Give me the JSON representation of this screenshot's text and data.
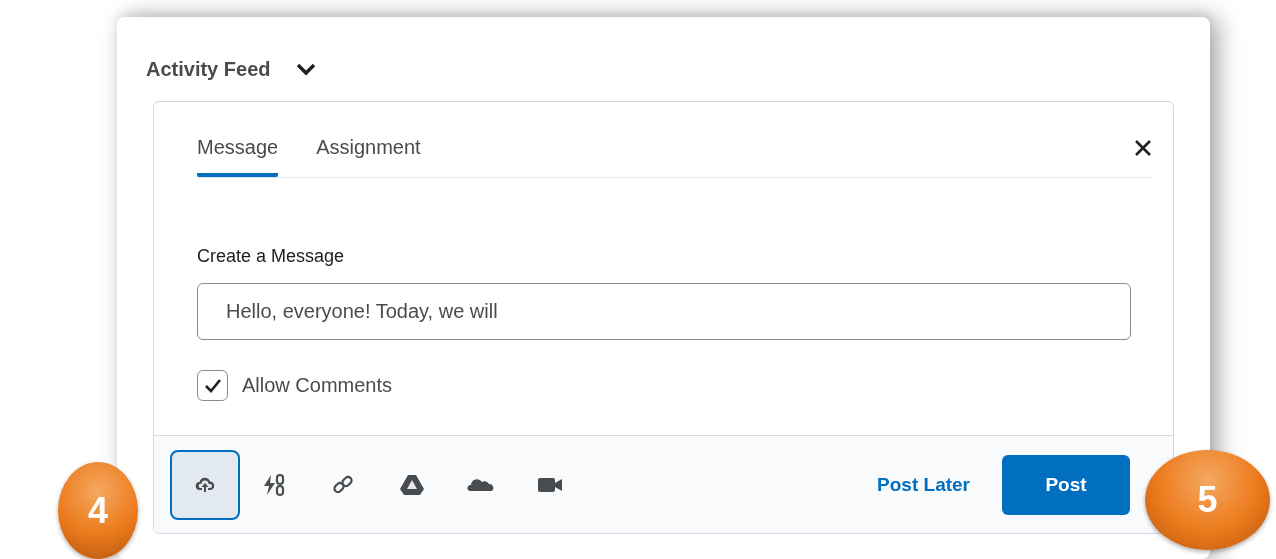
{
  "header": {
    "title": "Activity Feed"
  },
  "tabs": [
    {
      "label": "Message",
      "selected": true
    },
    {
      "label": "Assignment",
      "selected": false
    }
  ],
  "form": {
    "label": "Create a Message",
    "message": "Hello, everyone! Today, we will",
    "allow_comments": {
      "label": "Allow Comments",
      "checked": true
    }
  },
  "toolbar": {
    "tools": [
      {
        "kind": "upload",
        "selected": true
      },
      {
        "kind": "quicklink",
        "selected": false
      },
      {
        "kind": "link",
        "selected": false
      },
      {
        "kind": "drive",
        "selected": false
      },
      {
        "kind": "cloud",
        "selected": false
      },
      {
        "kind": "video",
        "selected": false
      }
    ],
    "post_later": "Post Later",
    "post": "Post"
  },
  "callouts": [
    {
      "number": "4"
    },
    {
      "number": "5"
    }
  ]
}
